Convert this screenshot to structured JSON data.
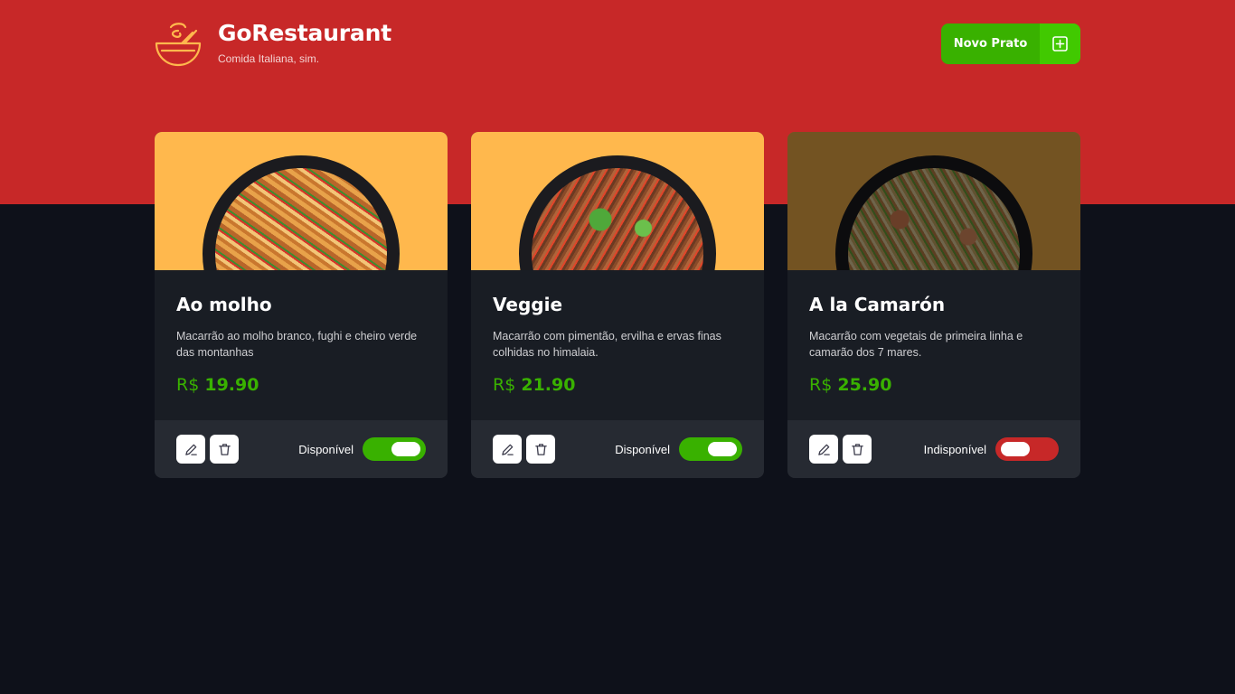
{
  "brand": {
    "name": "GoRestaurant",
    "subtitle": "Comida Italiana, sim.",
    "logo_icon": "food-bowl-icon"
  },
  "header": {
    "new_dish_label": "Novo Prato",
    "new_dish_icon": "plus-square-icon"
  },
  "colors": {
    "header_red": "#c72828",
    "background": "#0e111a",
    "card": "#191d24",
    "card_footer": "#262a32",
    "green": "#39b100",
    "red": "#c72828",
    "image_bg": "#ffb84d"
  },
  "dishes": [
    {
      "name": "Ao molho",
      "description": "Macarrão ao molho branco, fughi e cheiro verde das montanhas",
      "currency": "R$",
      "price": "19.90",
      "availability_label": "Disponível",
      "available": true,
      "edit_icon": "pencil-icon",
      "delete_icon": "trash-icon"
    },
    {
      "name": "Veggie",
      "description": "Macarrão com pimentão, ervilha e ervas finas colhidas no himalaia.",
      "currency": "R$",
      "price": "21.90",
      "availability_label": "Disponível",
      "available": true,
      "edit_icon": "pencil-icon",
      "delete_icon": "trash-icon"
    },
    {
      "name": "A la Camarón",
      "description": "Macarrão com vegetais de primeira linha e camarão dos 7 mares.",
      "currency": "R$",
      "price": "25.90",
      "availability_label": "Indisponível",
      "available": false,
      "edit_icon": "pencil-icon",
      "delete_icon": "trash-icon"
    }
  ]
}
